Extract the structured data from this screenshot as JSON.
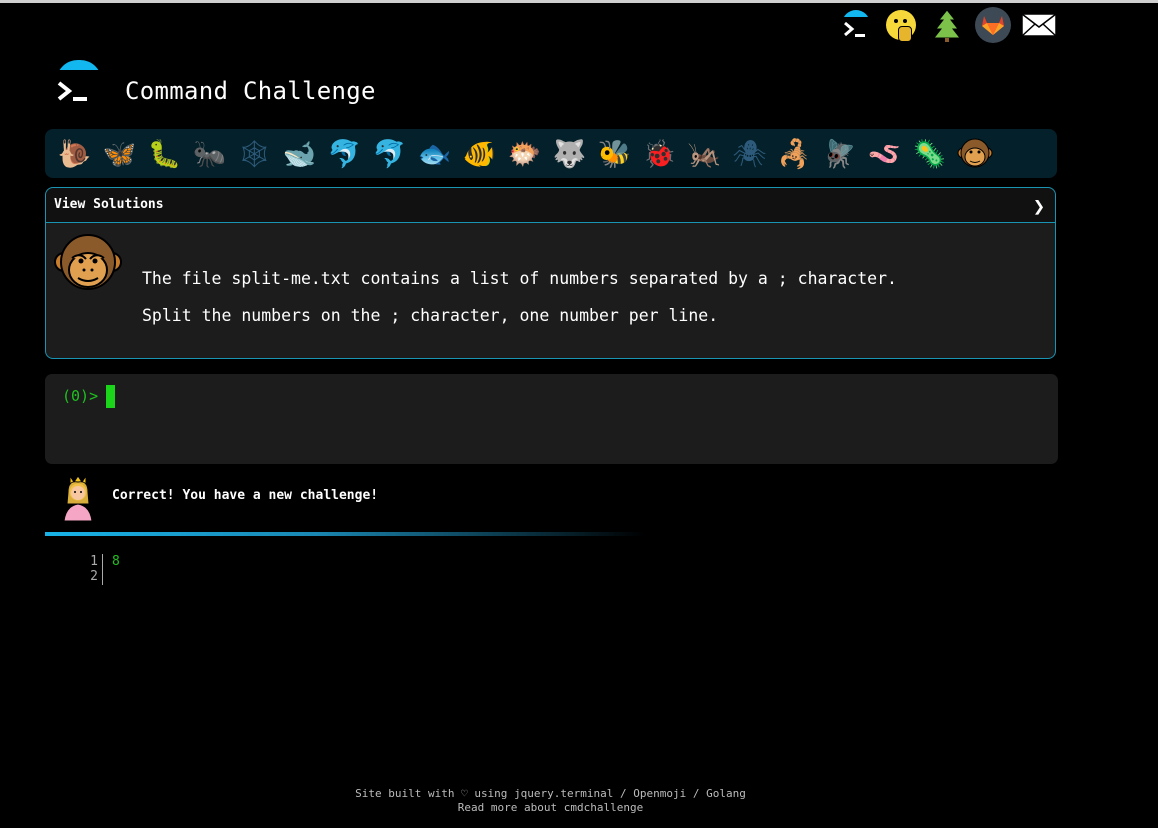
{
  "header": {
    "title": "Command Challenge",
    "top_icons": [
      "terminal-icon",
      "shushing-face-icon",
      "tree-icon",
      "gitlab-icon",
      "mail-icon"
    ]
  },
  "animal_bar": {
    "animals": [
      "snail",
      "butterfly",
      "caterpillar",
      "ant",
      "spider-web",
      "whale",
      "dolphin",
      "dolphin",
      "fish",
      "tropical-fish",
      "blowfish",
      "wolf",
      "bee",
      "ladybug",
      "cricket",
      "spider",
      "scorpion",
      "fly",
      "worm",
      "microbe",
      "monkey"
    ]
  },
  "solutions": {
    "label": "View Solutions",
    "chevron": "❯",
    "line1": "The file split-me.txt contains a list of numbers separated by a ; character.",
    "line2": "Split the numbers on the ; character, one number per line."
  },
  "terminal": {
    "prompt": "(0)>"
  },
  "result": {
    "message": "Correct! You have a new challenge!"
  },
  "output": {
    "line_numbers": "1\n2",
    "lines": "8"
  },
  "footer": {
    "line1_prefix": "Site built with ♡ using ",
    "link_terminal": "jquery.terminal",
    "sep1": " / ",
    "link_openmoji": "Openmoji",
    "sep2": " / ",
    "link_golang": "Golang",
    "read_more": "Read more about cmdchallenge"
  },
  "colors": {
    "accent": "#13b7f0",
    "prompt_green": "#1fc11f",
    "card_border": "#1994b3",
    "card_bg": "#1c1c1c",
    "animal_bar_bg": "#04202a"
  }
}
